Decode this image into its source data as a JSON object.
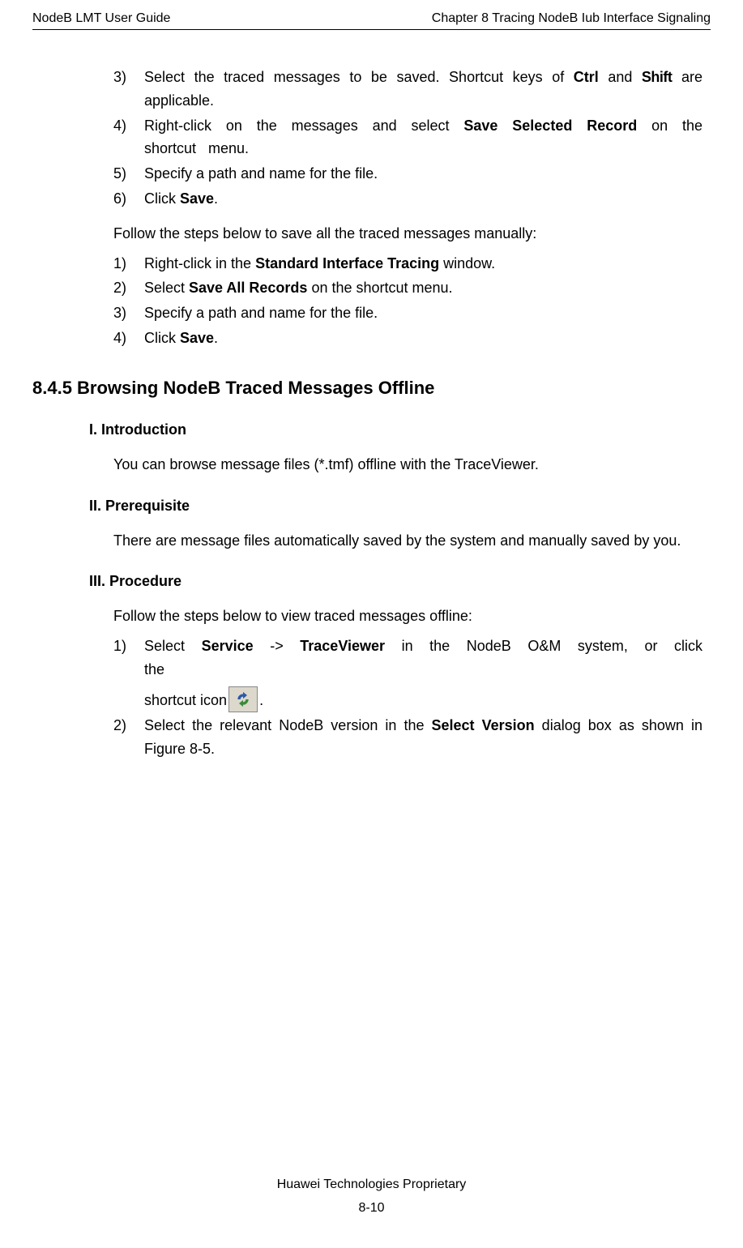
{
  "header": {
    "left": "NodeB LMT User Guide",
    "right": "Chapter 8  Tracing NodeB Iub Interface Signaling"
  },
  "listA": {
    "3": {
      "num": "3)",
      "pre": "Select the traced messages to be saved. Shortcut keys of ",
      "b1": "Ctrl",
      "mid": " and ",
      "b2": "Shift",
      "post": " are applicable."
    },
    "4": {
      "num": "4)",
      "pre": "Right-click on the messages and select ",
      "b1": "Save Selected Record",
      "post": " on the shortcut menu."
    },
    "5": {
      "num": "5)",
      "text": "Specify a path and name for the file."
    },
    "6": {
      "num": "6)",
      "pre": "Click ",
      "b1": "Save",
      "post": "."
    }
  },
  "paraFollow": "Follow the steps below to save all the traced messages manually:",
  "listB": {
    "1": {
      "num": "1)",
      "pre": "Right-click in the ",
      "b1": "Standard Interface Tracing",
      "post": " window."
    },
    "2": {
      "num": "2)",
      "pre": "Select ",
      "b1": "Save All Records",
      "post": " on the shortcut menu."
    },
    "3": {
      "num": "3)",
      "text": "Specify a path and name for the file."
    },
    "4": {
      "num": "4)",
      "pre": "Click ",
      "b1": "Save",
      "post": "."
    }
  },
  "h2": "8.4.5  Browsing NodeB Traced Messages Offline",
  "sec1": {
    "title": "I. Introduction",
    "para": "You can browse message files (*.tmf) offline with the TraceViewer."
  },
  "sec2": {
    "title": "II. Prerequisite",
    "para": "There are message files automatically saved by the system and manually saved by you."
  },
  "sec3": {
    "title": "III. Procedure",
    "para": "Follow the steps below to view traced messages offline:"
  },
  "listC": {
    "1": {
      "num": "1)",
      "pre": "Select ",
      "b1": "Service",
      "mid1": " -> ",
      "b2": "TraceViewer",
      "post1": " in the NodeB O&M system, or click the",
      "line2pre": "shortcut icon ",
      "line2post": "."
    },
    "2": {
      "num": "2)",
      "pre": "Select the relevant NodeB version in the ",
      "b1": "Select Version",
      "post": " dialog box as shown in Figure 8-5."
    }
  },
  "footer": {
    "l1": "Huawei Technologies Proprietary",
    "l2": "8-10"
  }
}
